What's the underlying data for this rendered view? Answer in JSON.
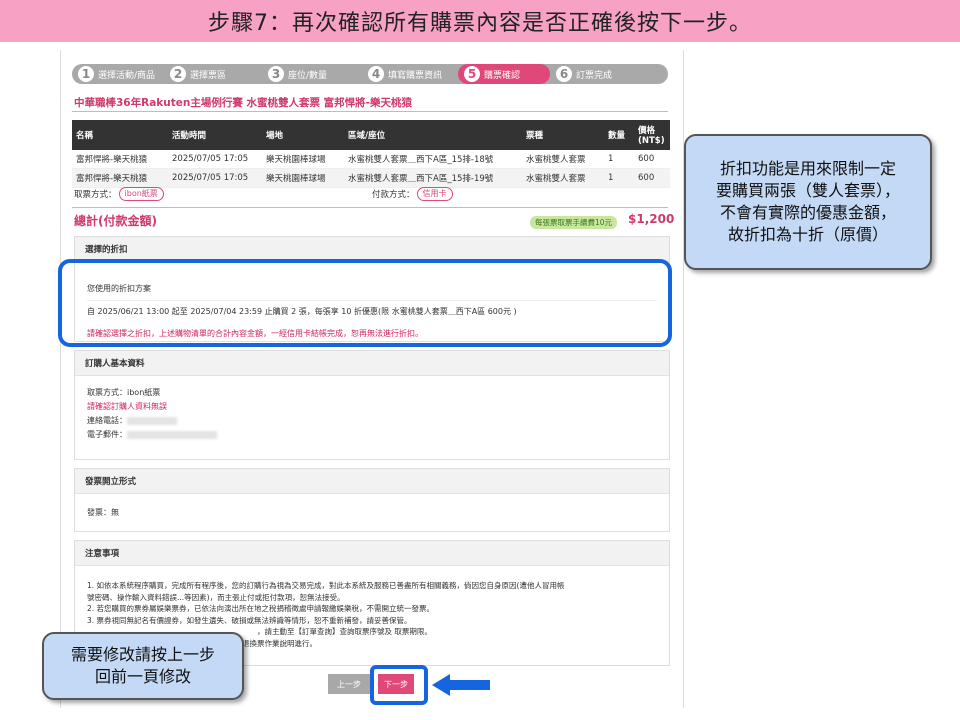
{
  "slide_title": "步驟7：再次確認所有購票內容是否正確後按下一步。",
  "steps": [
    {
      "num": "1",
      "label": "選擇活動/商品"
    },
    {
      "num": "2",
      "label": "選擇票區"
    },
    {
      "num": "3",
      "label": "座位/數量"
    },
    {
      "num": "4",
      "label": "填寫購票資訊"
    },
    {
      "num": "5",
      "label": "購票確認"
    },
    {
      "num": "6",
      "label": "訂票完成"
    }
  ],
  "event_title": "中華職棒36年Rakuten主場例行賽 水蜜桃雙人套票 富邦悍將-樂天桃猿",
  "table": {
    "headers": [
      "名稱",
      "活動時間",
      "場地",
      "區域/座位",
      "票種",
      "數量",
      "價格(NT$)"
    ],
    "rows": [
      [
        "富邦悍將-樂天桃猿",
        "2025/07/05 17:05",
        "樂天桃園棒球場",
        "水蜜桃雙人套票＿西下A區_15排-18號",
        "水蜜桃雙人套票",
        "1",
        "600"
      ],
      [
        "富邦悍將-樂天桃猿",
        "2025/07/05 17:05",
        "樂天桃園棒球場",
        "水蜜桃雙人套票＿西下A區_15排-19號",
        "水蜜桃雙人套票",
        "1",
        "600"
      ]
    ]
  },
  "pickup": {
    "label": "取票方式：",
    "value": "ibon紙票"
  },
  "payment": {
    "label": "付款方式：",
    "value": "信用卡"
  },
  "total": {
    "label": "總計(付款金額)",
    "fee_note": "每張票取票手續費10元",
    "amount": "$1,200"
  },
  "discount": {
    "header": "選擇的折扣",
    "plan_title": "您使用的折扣方案",
    "plan_detail": "自 2025/06/21 13:00 起至 2025/07/04 23:59 止購買 2 張，每張享 10 折優惠(限 水蜜桃雙人套票＿西下A區 600元 )",
    "warning": "請確認選擇之折扣，上述購物清單的合計內容金額，一經信用卡結帳完成，恕再無法進行折扣。"
  },
  "buyer": {
    "header": "訂購人基本資料",
    "pickup_line": "取票方式：ibon紙票",
    "confirm_note": "請確認訂購人資料無誤",
    "phone_label": "連絡電話：",
    "email_label": "電子郵件："
  },
  "invoice": {
    "header": "發票開立形式",
    "line": "發票：無"
  },
  "notes": {
    "header": "注意事項",
    "lines": [
      "1. 如依本系統程序購買，完成所有程序後，您的訂購行為視為交易完成，對此本系統及服務已善盡所有相關義務，倘因您自身原因(遭他人冒用帳",
      "號密碼、操作輸入資料錯誤...等因素)，而主張止付或拒付款項，恕無法接受。",
      "2. 若您購買的票券屬娛樂票券，已依法向演出所在地之稅捐稽徵處申請報繳娛樂稅，不需開立統一發票。",
      "3. 票券視同無記名有價證券，如發生遺失、破損或無法辨識等情形，恕不重新補發，請妥善保管。",
      "，請主動至【訂單查詢】查詢取票序號及 取票期限。",
      "相關退換票作業說明進行。"
    ]
  },
  "buttons": {
    "prev": "上一步",
    "next": "下一步"
  },
  "callouts": {
    "discount_explain": [
      "折扣功能是用來限制一定",
      "要購買兩張（雙人套票），",
      "不會有實際的優惠金額，",
      "故折扣為十折（原價）"
    ],
    "back_explain": [
      "需要修改請按上一步",
      "回前一頁修改"
    ]
  },
  "colors": {
    "accent": "#e0487a",
    "title_bar": "#f7a1c4",
    "highlight": "#1565e0",
    "callout_bg": "#c3d9f6"
  }
}
